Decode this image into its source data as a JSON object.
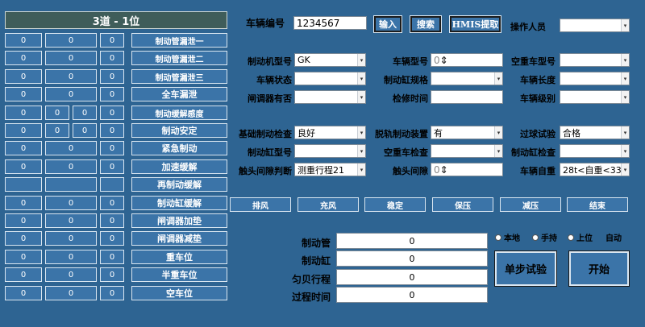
{
  "left": {
    "title": "3道 - 1位",
    "rows": [
      {
        "cells": [
          "0",
          "0",
          "0"
        ],
        "label": "制动管漏泄一"
      },
      {
        "cells": [
          "0",
          "0",
          "0"
        ],
        "label": "制动管漏泄二"
      },
      {
        "cells": [
          "0",
          "0",
          "0"
        ],
        "label": "制动管漏泄三"
      },
      {
        "cells": [
          "0",
          "0",
          "0"
        ],
        "label": "全车漏泄"
      },
      {
        "cells": [
          "0",
          "0",
          "0",
          "0"
        ],
        "label": "制动缓解感度"
      },
      {
        "cells": [
          "0",
          "0",
          "0",
          "0"
        ],
        "label": "制动安定"
      },
      {
        "cells": [
          "0",
          "0",
          "0"
        ],
        "label": "紧急制动"
      },
      {
        "cells": [
          "0",
          "0",
          "0"
        ],
        "label": "加速缓解"
      },
      {
        "cells": [],
        "label": "再制动缓解"
      },
      {
        "cells": [
          "0",
          "0",
          "0"
        ],
        "label": "制动缸缓解"
      },
      {
        "cells": [
          "0",
          "0",
          "0"
        ],
        "label": "闸调器加垫"
      },
      {
        "cells": [
          "0",
          "0",
          "0"
        ],
        "label": "闸调器减垫"
      },
      {
        "cells": [
          "0",
          "0",
          "0"
        ],
        "label": "重车位"
      },
      {
        "cells": [
          "0",
          "0",
          "0"
        ],
        "label": "半重车位"
      },
      {
        "cells": [
          "0",
          "0",
          "0"
        ],
        "label": "空车位"
      }
    ]
  },
  "top": {
    "vehicle_no_label": "车辆编号",
    "vehicle_no": "1234567",
    "input_btn": "输入",
    "search_btn": "搜索",
    "hmis_btn": "HMIS提取",
    "operator_label": "操作人员",
    "operator_value": ""
  },
  "fields": {
    "brake_model_label": "制动机型号",
    "brake_model": "GK",
    "car_model_label": "车辆型号",
    "car_model": "0",
    "empty_heavy_label": "空重车型号",
    "empty_heavy": "",
    "vehicle_state_label": "车辆状态",
    "vehicle_state": "",
    "cyl_spec_label": "制动缸规格",
    "cyl_spec": "",
    "car_length_label": "车辆长度",
    "car_length": "",
    "adjuster_label": "闸调器有否",
    "adjuster": "",
    "repair_time_label": "检修时间",
    "repair_time": "",
    "car_level_label": "车辆级别",
    "car_level": "",
    "basic_check_label": "基础制动检查",
    "basic_check": "良好",
    "derail_label": "脱轨制动装置",
    "derail": "有",
    "hump_label": "过球试验",
    "hump": "合格",
    "cyl_type_label": "制动缸型号",
    "cyl_type": "",
    "empty_check_label": "空重车检查",
    "empty_check": "",
    "cyl_check_label": "制动缸检查",
    "cyl_check": "",
    "gap_judge_label": "触头间隙判断",
    "gap_judge": "测重行程21",
    "gap_label": "触头间隙",
    "gap": "0",
    "self_weight_label": "车辆自重",
    "self_weight": "28t<自重<33"
  },
  "actions": [
    "排风",
    "充风",
    "稳定",
    "保压",
    "减压",
    "结束"
  ],
  "readouts": [
    {
      "label": "制动管",
      "value": "0"
    },
    {
      "label": "制动缸",
      "value": "0"
    },
    {
      "label": "匀贝行程",
      "value": "0"
    },
    {
      "label": "过程时间",
      "value": "0"
    }
  ],
  "modes": {
    "local": "本地",
    "manual": "手持",
    "upper": "上位",
    "auto": "自动"
  },
  "step_test": "单步试验",
  "start": "开始"
}
